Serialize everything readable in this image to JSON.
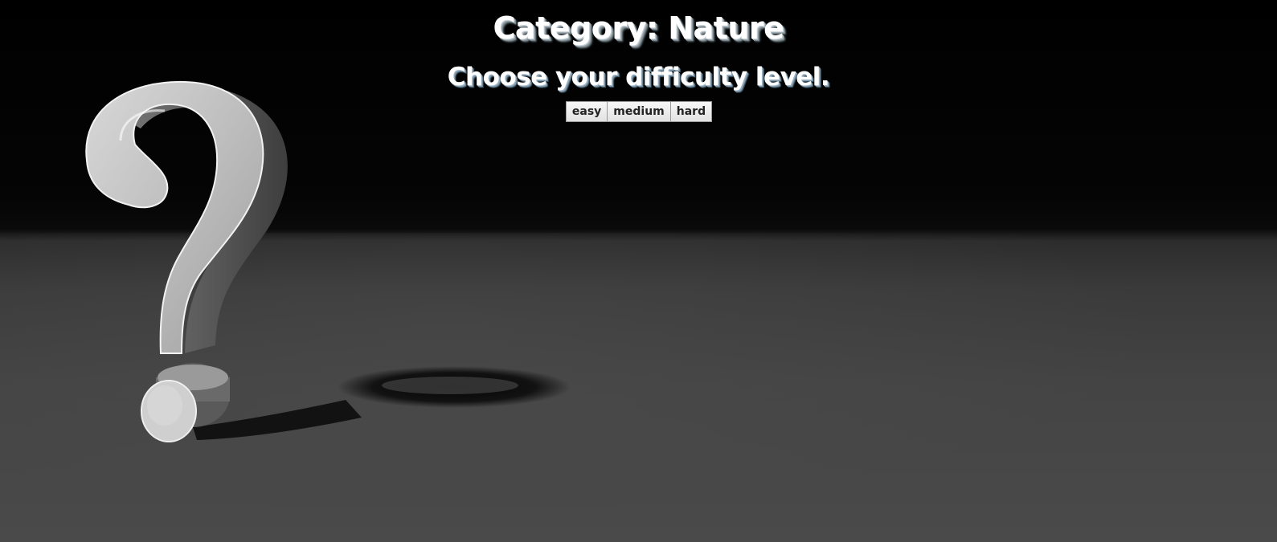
{
  "header": {
    "category_title": "Category: Nature",
    "difficulty_prompt": "Choose your difficulty level."
  },
  "difficulty_buttons": [
    {
      "label": "easy"
    },
    {
      "label": "medium"
    },
    {
      "label": "hard"
    }
  ],
  "background": {
    "graphic": "question-mark-3d-icon",
    "colors": {
      "backdrop_top": "#000000",
      "floor": "#444444",
      "glyph": "#bdbdbd"
    }
  }
}
